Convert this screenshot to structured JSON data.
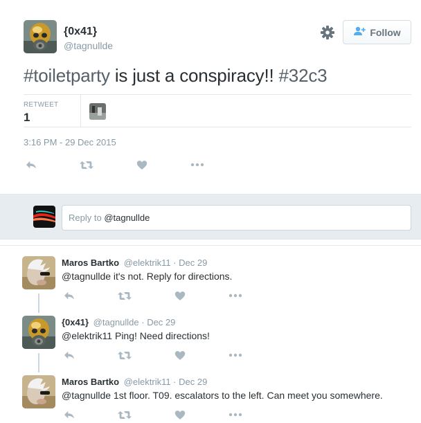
{
  "main_tweet": {
    "display_name": "{0x41}",
    "screen_name": "@tagnullde",
    "text_parts": [
      "#toiletparty",
      " is just a conspiracy!! ",
      "#32c3"
    ],
    "follow_label": "Follow",
    "retweet_label": "RETWEET",
    "retweet_count": "1",
    "timestamp": "3:16 PM - 29 Dec 2015"
  },
  "reply_box": {
    "placeholder_prefix": "Reply to ",
    "mention": "@tagnullde"
  },
  "replies": [
    {
      "name": "Maros Bartko",
      "meta": "@elektrik11 · Dec 29",
      "text": "@tagnullde it's not. Reply for directions."
    },
    {
      "name": "{0x41}",
      "meta": "@tagnullde · Dec 29",
      "text": "@elektrik11 Ping! Need directions!"
    },
    {
      "name": "Maros Bartko",
      "meta": "@elektrik11 · Dec 29",
      "text": "@tagnullde 1st floor. T09. escalators to the left. Can meet you somewhere."
    }
  ],
  "icons": {
    "settings": "gear-icon",
    "follow": "add-user-icon",
    "reply": "reply-icon",
    "retweet": "retweet-icon",
    "like": "heart-icon",
    "more": "more-icon"
  },
  "colors": {
    "text": "#292f33",
    "muted": "#8899a6",
    "icon": "#aab8c2",
    "reply_bg": "#e6ecf0",
    "follow_icon": "#55acee"
  }
}
